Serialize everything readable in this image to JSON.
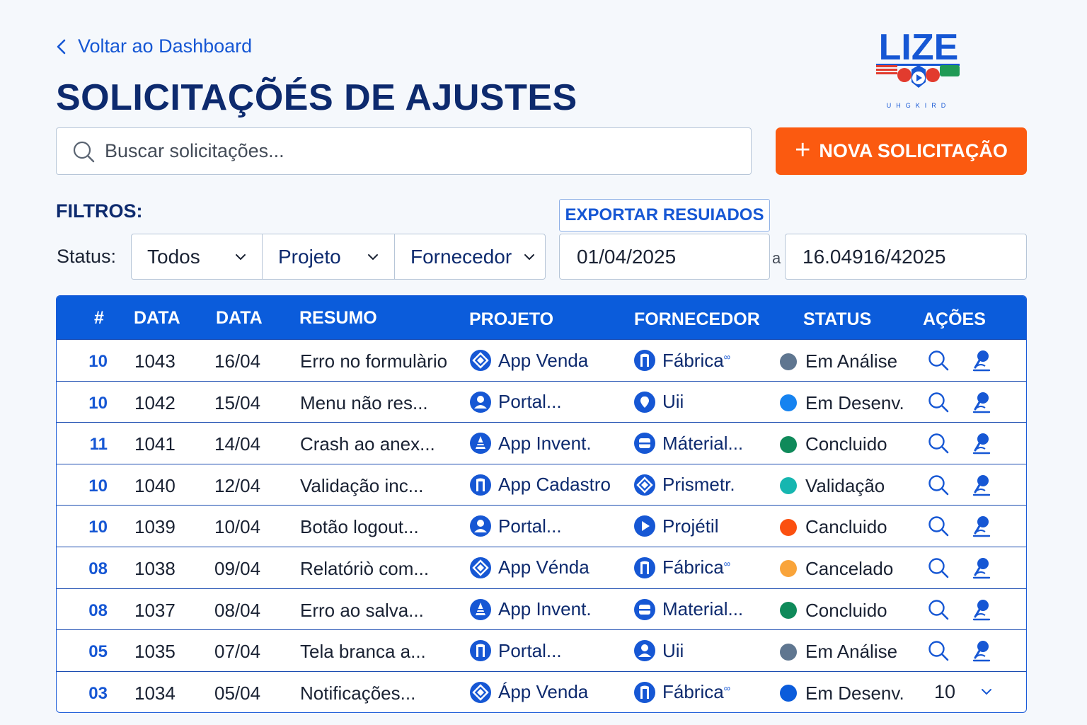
{
  "nav": {
    "back_label": "Voltar ao Dashboard"
  },
  "page": {
    "title": "SOLICITAÇÕÉS DE AJUSTES"
  },
  "logo": {
    "text": "LIZE",
    "subtext": "UHGKIRD"
  },
  "search": {
    "placeholder": "Buscar solicitações..."
  },
  "actions": {
    "new_label": "NOVA SOLICITAÇÃO",
    "export_label": "EXPORTAR RESUIADOS"
  },
  "filters": {
    "label": "FILTROS:",
    "status_label": "Status:",
    "status_value": "Todos",
    "projeto_value": "Projeto",
    "fornecedor_value": "Fornecedor",
    "date_from": "01/04/2025",
    "date_sep": "a",
    "date_to": "16.04916/42025"
  },
  "table": {
    "headers": [
      "#",
      "DATA",
      "DATA",
      "RESUMO",
      "PROJETO",
      "FORNECEDOR",
      "STATUS",
      "AÇÕES"
    ],
    "rows": [
      {
        "num": "10",
        "id": "1043",
        "date": "16/04",
        "summary": "Erro no formulàrio",
        "project": "App Venda",
        "project_icon": "diamond-icon",
        "vendor": "Fábrica",
        "vendor_sup": "∞",
        "vendor_icon": "door-icon",
        "status": "Em Análise",
        "status_color": "#5f7690"
      },
      {
        "num": "10",
        "id": "1042",
        "date": "15/04",
        "summary": "Menu não res...",
        "project": "Portal...",
        "project_icon": "user-icon",
        "vendor": "Uii",
        "vendor_sup": "",
        "vendor_icon": "pin-icon",
        "status": "Em Desenv.",
        "status_color": "#1683f0"
      },
      {
        "num": "11",
        "id": "1041",
        "date": "14/04",
        "summary": "Crash ao anex...",
        "project": "App Invent.",
        "project_icon": "cone-icon",
        "vendor": "Máterial...",
        "vendor_sup": "",
        "vendor_icon": "box-icon",
        "status": "Concluido",
        "status_color": "#0f8a5a"
      },
      {
        "num": "10",
        "id": "1040",
        "date": "12/04",
        "summary": "Validação inc...",
        "project": "App Cadastro",
        "project_icon": "door-icon",
        "vendor": "Prismetr.",
        "vendor_sup": "",
        "vendor_icon": "diamond-icon",
        "status": "Validação",
        "status_color": "#16b6b0"
      },
      {
        "num": "10",
        "id": "1039",
        "date": "10/04",
        "summary": "Botão logout...",
        "project": "Portal...",
        "project_icon": "user-icon",
        "vendor": "Projétil",
        "vendor_sup": "",
        "vendor_icon": "play-icon",
        "status": "Cancluido",
        "status_color": "#fb5010"
      },
      {
        "num": "08",
        "id": "1038",
        "date": "09/04",
        "summary": "Relatóriò com...",
        "project": "App Vénda",
        "project_icon": "diamond-icon",
        "vendor": "Fábrica",
        "vendor_sup": "∞",
        "vendor_icon": "door-icon",
        "status": "Cancelado",
        "status_color": "#f9a43a"
      },
      {
        "num": "08",
        "id": "1037",
        "date": "08/04",
        "summary": "Erro ao salva...",
        "project": "App Invent.",
        "project_icon": "cone-icon",
        "vendor": "Material...",
        "vendor_sup": "",
        "vendor_icon": "box-icon",
        "status": "Concluido",
        "status_color": "#0f8a5a"
      },
      {
        "num": "05",
        "id": "1035",
        "date": "07/04",
        "summary": "Tela branca a...",
        "project": "Portal...",
        "project_icon": "door-icon",
        "vendor": "Uii",
        "vendor_sup": "",
        "vendor_icon": "user-icon",
        "status": "Em Análise",
        "status_color": "#5f7690"
      },
      {
        "num": "03",
        "id": "1034",
        "date": "05/04",
        "summary": "Notificações...",
        "project": "Ápp Venda",
        "project_icon": "diamond-icon",
        "vendor": "Fábrica",
        "vendor_sup": "∞",
        "vendor_icon": "door-icon",
        "status": "Em Desenv.",
        "status_color": "#0b5cdb"
      }
    ],
    "pager_value": "10"
  },
  "colors": {
    "primary": "#0b5cdb",
    "accent": "#fb5a10",
    "title": "#0d2a6e"
  }
}
